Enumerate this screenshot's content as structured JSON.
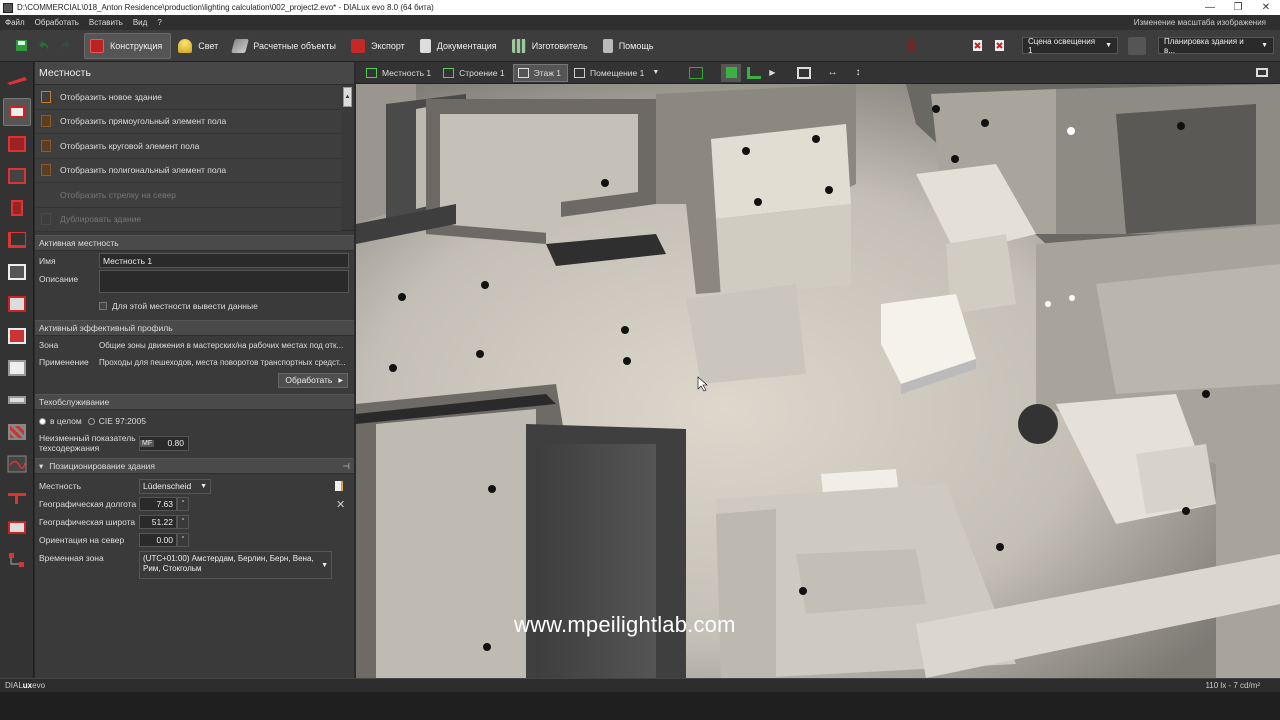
{
  "window": {
    "title": "D:\\COMMERCIAL\\018_Anton Residence\\production\\lighting calculation\\002_project2.evo* - DIALux evo 8.0  (64 бита)",
    "minimize": "—",
    "maximize": "❐",
    "close": "✕"
  },
  "menu": {
    "items": [
      "Файл",
      "Обработать",
      "Вставить",
      "Вид",
      "?"
    ],
    "right": "Изменение масштаба изображения"
  },
  "toolbar": {
    "tabs": [
      {
        "label": "Конструкция",
        "active": true
      },
      {
        "label": "Свет"
      },
      {
        "label": "Расчетные объекты"
      },
      {
        "label": "Экспорт"
      },
      {
        "label": "Документация"
      },
      {
        "label": "Изготовитель"
      },
      {
        "label": "Помощь"
      }
    ],
    "scene_dropdown": "Сцена освещения 1",
    "view_dropdown": "Планировка здания и в..."
  },
  "panel": {
    "title": "Местность",
    "actions": [
      {
        "label": "Отобразить новое здание",
        "enabled": true
      },
      {
        "label": "Отобразить прямоугольный элемент пола",
        "enabled": true
      },
      {
        "label": "Отобразить круговой элемент пола",
        "enabled": true
      },
      {
        "label": "Отобразить полигональный элемент пола",
        "enabled": true
      },
      {
        "label": "Отобразить стрелку на север",
        "enabled": false
      },
      {
        "label": "Дублировать здание",
        "enabled": false
      }
    ],
    "active_site": {
      "title": "Активная местность",
      "name_label": "Имя",
      "name_value": "Местность 1",
      "desc_label": "Описание",
      "desc_value": "",
      "checkbox_label": "Для этой местности вывести данные"
    },
    "profile": {
      "title": "Активный эффективный профиль",
      "zone_label": "Зона",
      "zone_value": "Общие зоны движения в мастерских/на рабочих местах под отк...",
      "use_label": "Применение",
      "use_value": "Проходы для пешеходов, места поворотов транспортных средст...",
      "edit_button": "Обработать"
    },
    "maintenance": {
      "title": "Техобслуживание",
      "radio1": "в целом",
      "radio2": "CIE 97:2005",
      "mf_label": "Неизменный показатель техсодержания",
      "mf_tag": "MF",
      "mf_value": "0.80"
    },
    "positioning": {
      "title": "Позиционирование здания",
      "collapse": "▾",
      "pin": "⊣",
      "site_label": "Местность",
      "site_value": "Lüdenscheid",
      "lon_label": "Географическая долгота",
      "lon_value": "7.63",
      "lat_label": "Географическая широта",
      "lat_value": "51.22",
      "north_label": "Ориентация на север",
      "north_value": "0.00",
      "tz_label": "Временная зона",
      "tz_value": "(UTC+01:00) Амстердам, Берлин, Берн, Вена, Рим, Стокгольм",
      "unit": "°"
    }
  },
  "viewbar": {
    "tabs": [
      "Местность 1",
      "Строение 1",
      "Этаж 1",
      "Помещение 1"
    ]
  },
  "viewport": {
    "watermark": "www.mpeilightlab.com"
  },
  "status": {
    "left_prefix": "DIAL",
    "left_bold": "ux",
    "left_suffix": "evo",
    "right": "110 lx - 7 cd/m²"
  },
  "colors": {
    "accent_red": "#cc2b2b",
    "accent_green": "#3cb043",
    "panel_bg": "#3a3a3a"
  }
}
